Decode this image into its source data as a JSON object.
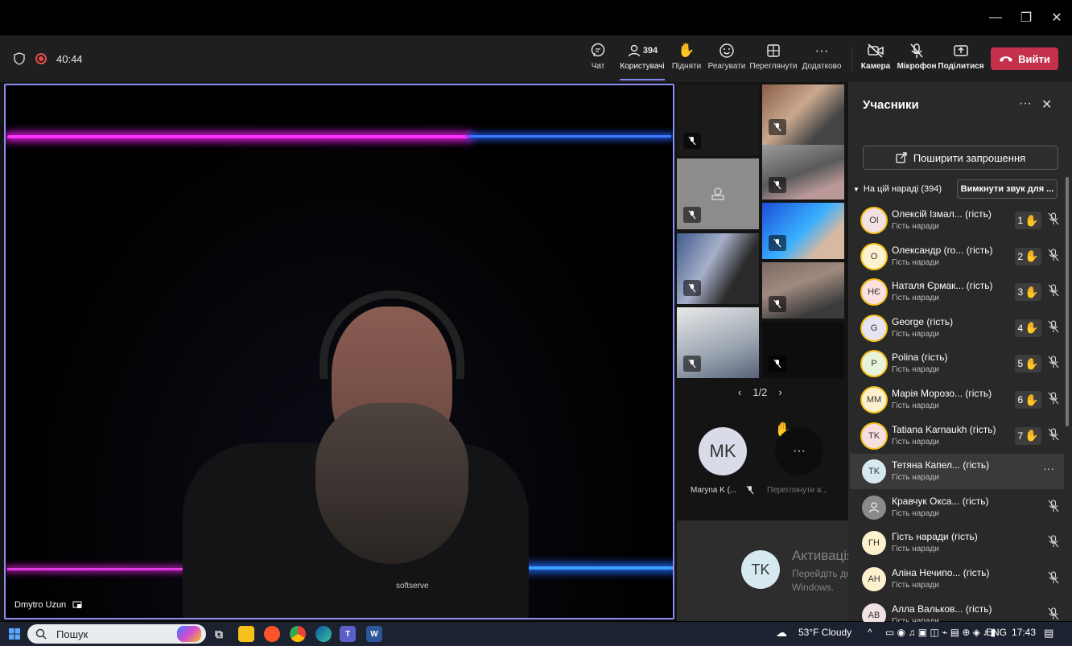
{
  "meeting": {
    "timer": "40:44",
    "toolbar": {
      "chat": "Чат",
      "people": "Користувачі",
      "people_count": "394",
      "raise": "Підняти",
      "react": "Реагувати",
      "view": "Переглянути",
      "more": "Додатково",
      "camera": "Камера",
      "mic": "Мікрофон",
      "share": "Поділитися",
      "leave": "Вийти"
    },
    "speaker": {
      "name": "Dmytro Uzun",
      "shirt_text": "softserve"
    },
    "gallery": {
      "page": "1/2",
      "overflow_avatar": {
        "initials": "MK",
        "name": "Maryna K (...",
        "color": "#d9dbe8"
      },
      "overflow_more": "Переглянути в...",
      "bottom_tile_avatar": "TK"
    }
  },
  "panel": {
    "title": "Учасники",
    "invite": "Поширити запрошення",
    "section": "На цій нараді (394)",
    "mute_all": "Вимкнути звук для ...",
    "participants": [
      {
        "initials": "OI",
        "name": "Олексій Ізмал...",
        "tag": "(гість)",
        "role": "Гість наради",
        "hand": "1",
        "bg": "#f3e0e3",
        "ring": "#f5c11a"
      },
      {
        "initials": "O",
        "name": "Олександр (го...",
        "tag": "(гість)",
        "role": "Гість наради",
        "hand": "2",
        "bg": "#fdf2d0",
        "ring": "#f5c11a"
      },
      {
        "initials": "НЄ",
        "name": "Наталя Єрмак...",
        "tag": "(гість)",
        "role": "Гість наради",
        "hand": "3",
        "bg": "#fbe0e0",
        "ring": "#f5c11a"
      },
      {
        "initials": "G",
        "name": "George",
        "tag": "(гість)",
        "role": "Гість наради",
        "hand": "4",
        "bg": "#e6e3f3",
        "ring": "#f5c11a"
      },
      {
        "initials": "P",
        "name": "Polina",
        "tag": "(гість)",
        "role": "Гість наради",
        "hand": "5",
        "bg": "#e8f3dc",
        "ring": "#f5c11a"
      },
      {
        "initials": "MM",
        "name": "Марія Морозо...",
        "tag": "(гість)",
        "role": "Гість наради",
        "hand": "6",
        "bg": "#fdf0cc",
        "ring": "#f5c11a"
      },
      {
        "initials": "TK",
        "name": "Tatiana Karnaukh",
        "tag": "(гість)",
        "role": "Гість наради",
        "hand": "7",
        "bg": "#f7dfe0",
        "ring": "#f5c11a"
      },
      {
        "initials": "TK",
        "name": "Тетяна Капел...",
        "tag": "(гість)",
        "role": "Гість наради",
        "hand": "",
        "bg": "#d6e9f0",
        "ring": ""
      },
      {
        "initials": "",
        "name": "Кравчук Окса...",
        "tag": "(гість)",
        "role": "Гість наради",
        "hand": "",
        "bg": "#8a8a8a",
        "ring": ""
      },
      {
        "initials": "ГН",
        "name": "Гість наради",
        "tag": "(гість)",
        "role": "Гість наради",
        "hand": "",
        "bg": "#fdf0cc",
        "ring": ""
      },
      {
        "initials": "АН",
        "name": "Аліна Нечипо...",
        "tag": "(гість)",
        "role": "Гість наради",
        "hand": "",
        "bg": "#fdf0cc",
        "ring": ""
      },
      {
        "initials": "АВ",
        "name": "Алла Вальков...",
        "tag": "(гість)",
        "role": "Гість наради",
        "hand": "",
        "bg": "#f3e0e3",
        "ring": ""
      }
    ]
  },
  "watermark": {
    "title": "Активація Windows",
    "sub": "Перейдіть до розділу \"Настройки\", щоб активувати Windows."
  },
  "taskbar": {
    "search": "Пошук",
    "weather": "53°F  Cloudy",
    "lang": "ENG",
    "time": "17:43"
  }
}
